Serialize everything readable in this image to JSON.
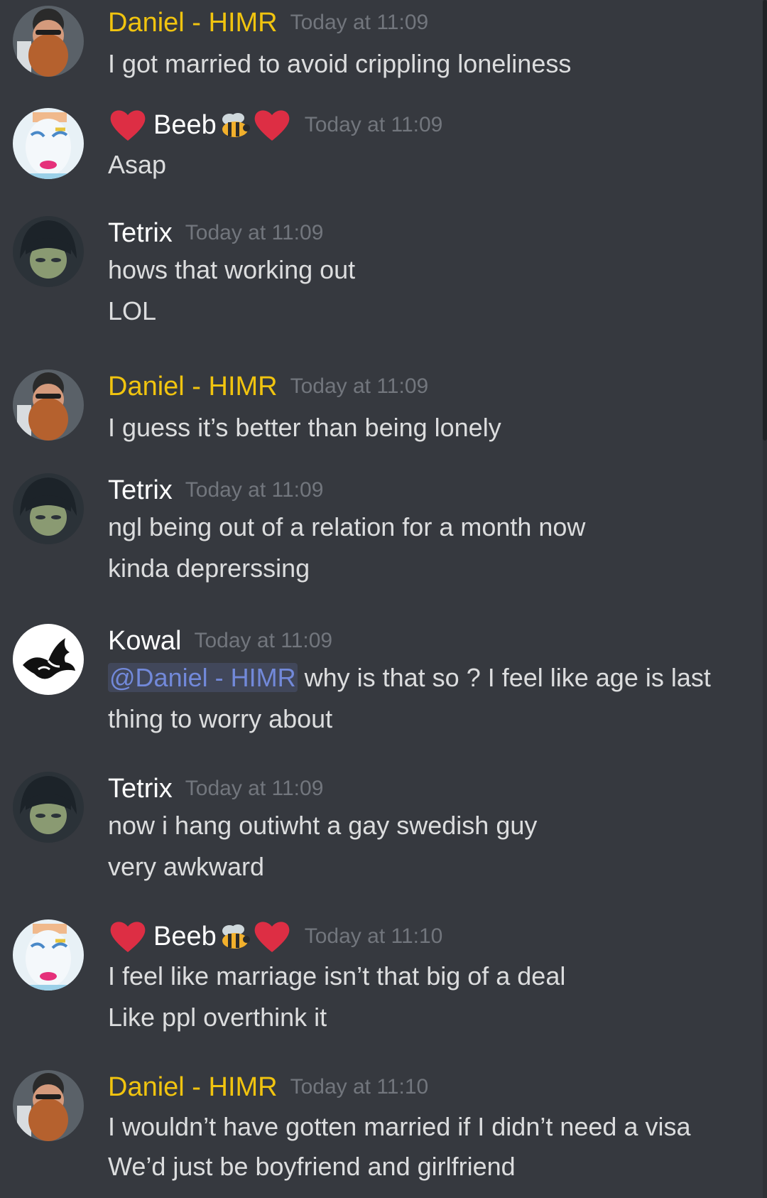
{
  "messages": [
    {
      "author": "Daniel - HIMR",
      "time": "Today at 11:09",
      "lines": [
        "I got married to avoid crippling loneliness"
      ]
    },
    {
      "author": "Beeb",
      "time": "Today at 11:09",
      "lines": [
        "Asap"
      ]
    },
    {
      "author": "Tetrix",
      "time": "Today at 11:09",
      "lines": [
        "hows that working out",
        "LOL"
      ]
    },
    {
      "author": "Daniel - HIMR",
      "time": "Today at 11:09",
      "lines": [
        "I guess it’s better than being lonely"
      ]
    },
    {
      "author": "Tetrix",
      "time": "Today at 11:09",
      "lines": [
        "ngl being out of a relation for a month now",
        "kinda deprerssing"
      ]
    },
    {
      "author": "Kowal",
      "time": "Today at 11:09",
      "mention": "@Daniel - HIMR",
      "lines": [
        " why is that so ? I feel like age is last",
        "thing to worry about"
      ]
    },
    {
      "author": "Tetrix",
      "time": "Today at 11:09",
      "lines": [
        "now i hang outiwht a gay swedish guy",
        "very awkward"
      ]
    },
    {
      "author": "Beeb",
      "time": "Today at 11:10",
      "lines": [
        "I feel like marriage isn’t that big of a deal",
        "Like ppl overthink it"
      ]
    },
    {
      "author": "Daniel - HIMR",
      "time": "Today at 11:10",
      "lines": [
        "I wouldn’t have gotten married if I didn’t need a visa",
        "We’d just be boyfriend and girlfriend"
      ]
    }
  ],
  "colors": {
    "background": "#36393f",
    "username_daniel": "#f1c40f",
    "username_default": "#ffffff",
    "timestamp": "#72767d",
    "text": "#dcddde",
    "mention": "#7289da"
  },
  "icons": {
    "badge_left": "red-heart-icon",
    "badge_bee": "bee-icon",
    "badge_right": "red-heart-icon"
  }
}
